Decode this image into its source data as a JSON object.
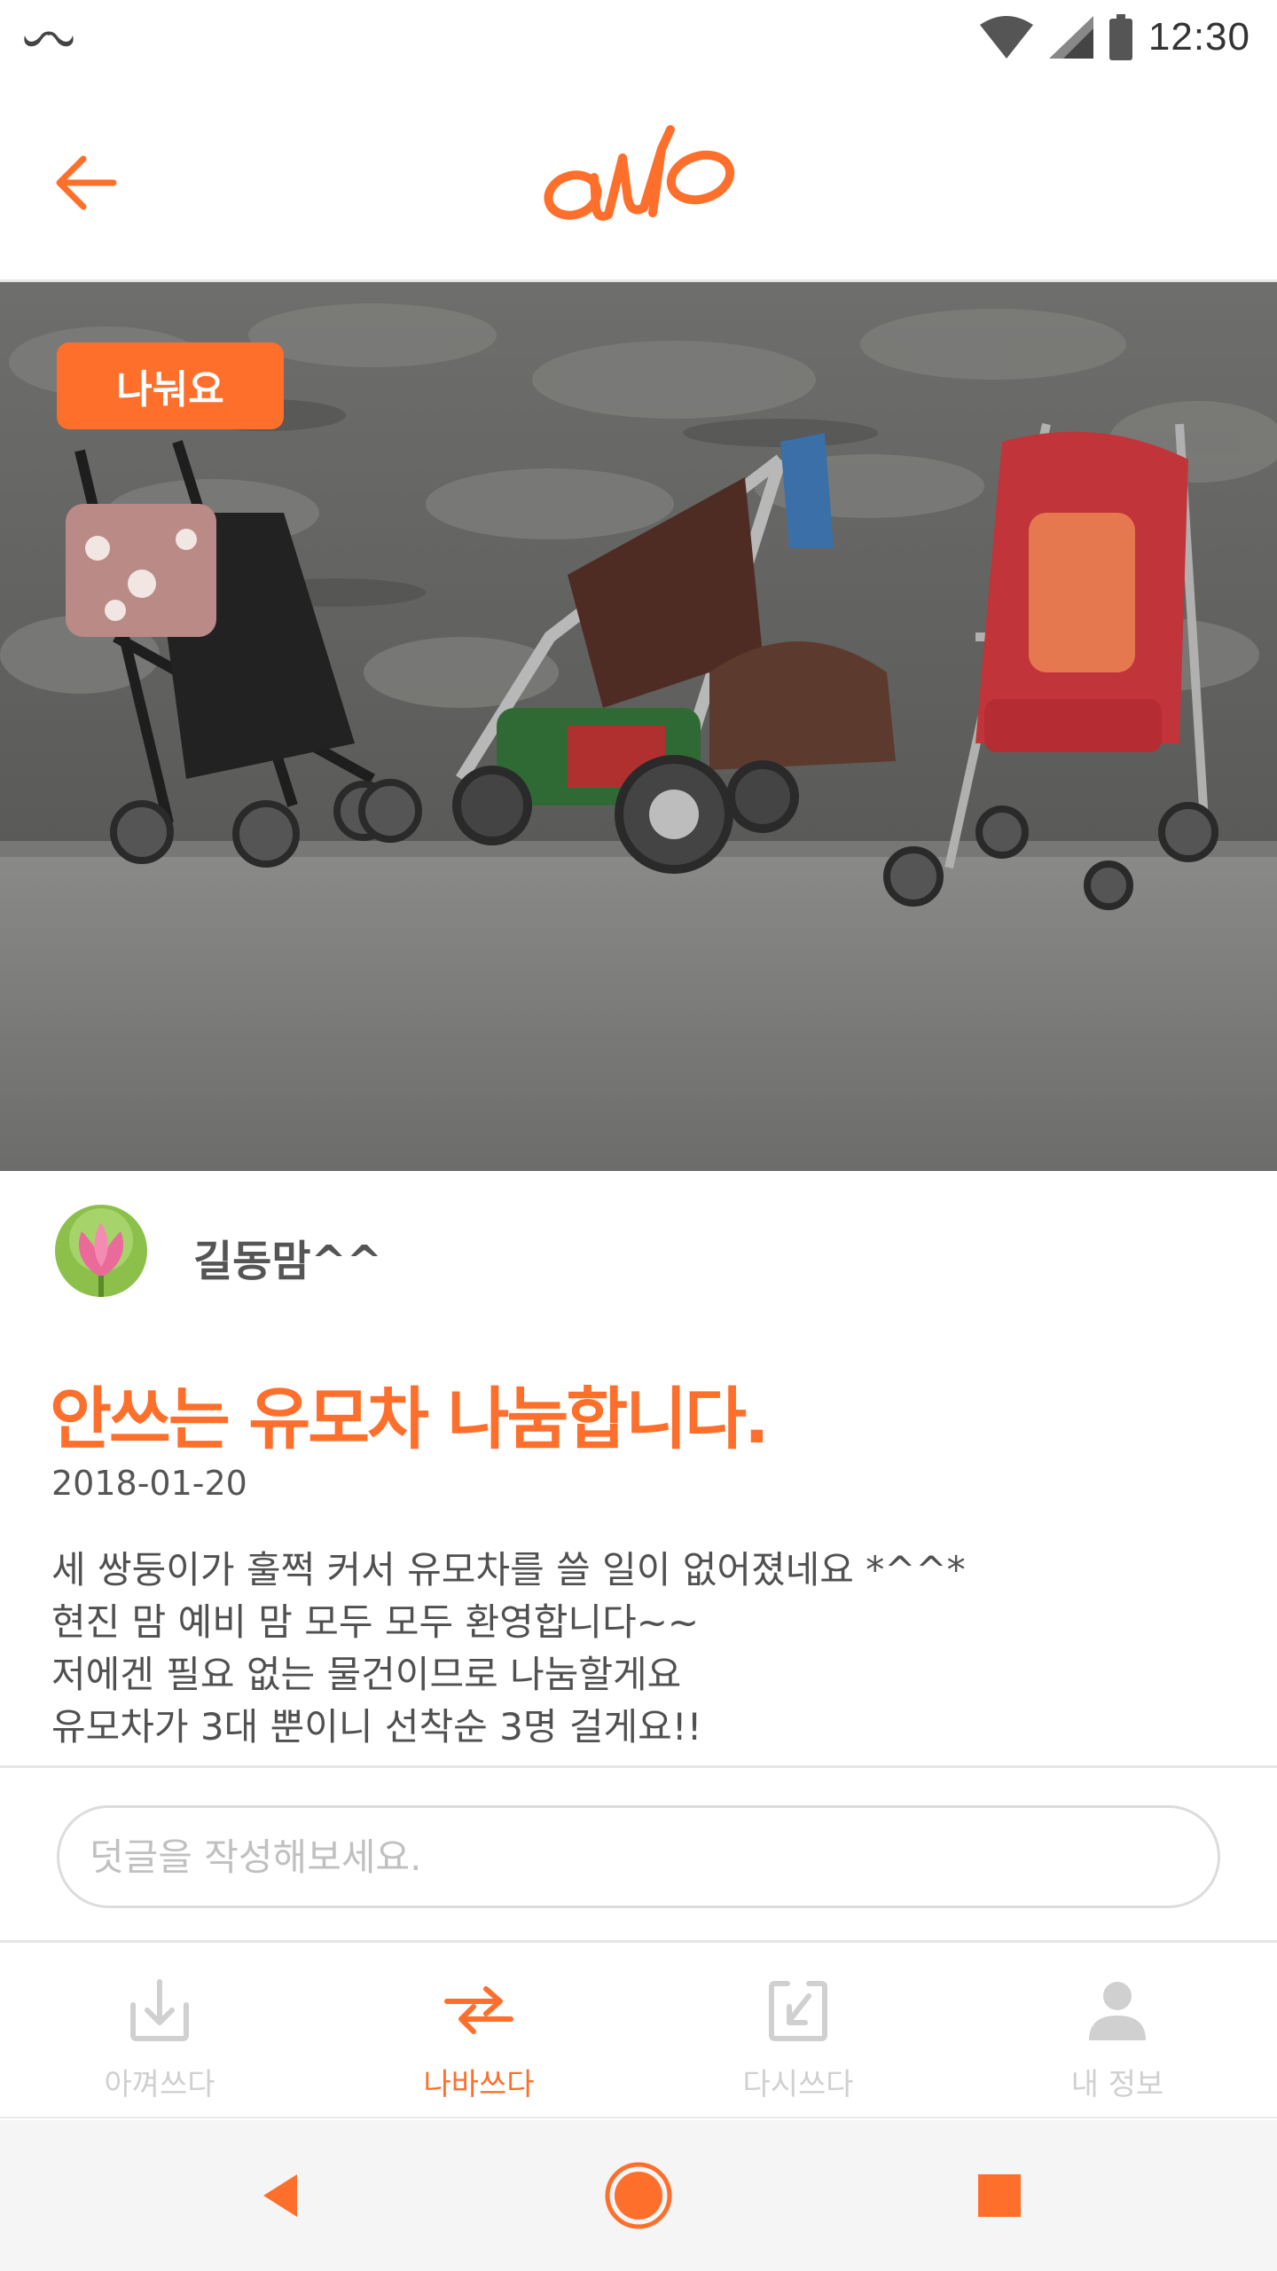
{
  "status_bar": {
    "time": "12:30",
    "icons": [
      "mustache-icon",
      "wifi-icon",
      "signal-icon",
      "battery-icon"
    ]
  },
  "header": {
    "back_icon": "arrow-left-icon",
    "logo_text": "aub"
  },
  "post": {
    "badge": "나눠요",
    "author_name": "길동맘^^",
    "title": "안쓰는 유모차 나눔합니다.",
    "date": "2018-01-20",
    "body_lines": [
      "세 쌍둥이가 훌쩍 커서 유모차를 쓸 일이 없어졌네요 *^^*",
      "현진 맘 예비 맘 모두 모두 환영합니다~~",
      "저에겐 필요 없는 물건이므로 나눔할게요",
      "유모차가 3대 뿐이니 선착순 3명 걸게요!!"
    ]
  },
  "comment": {
    "placeholder": "덧글을 작성해보세요."
  },
  "tabs": [
    {
      "label": "아껴쓰다",
      "icon": "download-box-icon",
      "active": false
    },
    {
      "label": "나바쓰다",
      "icon": "exchange-arrows-icon",
      "active": true
    },
    {
      "label": "다시쓰다",
      "icon": "return-box-icon",
      "active": false
    },
    {
      "label": "내 정보",
      "icon": "person-icon",
      "active": false
    }
  ],
  "nav": {
    "back": "nav-back-icon",
    "home": "nav-home-icon",
    "recent": "nav-recent-icon"
  },
  "colors": {
    "accent": "#ff6f2c",
    "tab_inactive": "#d0d0d0",
    "nav_bg": "#f5f5f5"
  }
}
